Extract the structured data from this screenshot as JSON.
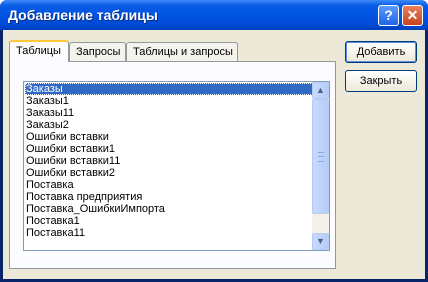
{
  "window": {
    "title": "Добавление таблицы",
    "help_glyph": "?",
    "close_glyph": "✕"
  },
  "tabs": [
    {
      "label": "Таблицы",
      "active": true
    },
    {
      "label": "Запросы",
      "active": false
    },
    {
      "label": "Таблицы и запросы",
      "active": false
    }
  ],
  "list": {
    "items": [
      "Заказы",
      "Заказы1",
      "Заказы11",
      "Заказы2",
      "Ошибки вставки",
      "Ошибки вставки1",
      "Ошибки вставки11",
      "Ошибки вставки2",
      "Поставка",
      "Поставка предприятия",
      "Поставка_ОшибкиИмпорта",
      "Поставка1",
      "Поставка11"
    ],
    "selected": "Заказы",
    "scroll_up_glyph": "▲",
    "scroll_down_glyph": "▼"
  },
  "buttons": {
    "add_label": "Добавить",
    "close_label": "Закрыть"
  },
  "colors": {
    "title_bar": "#0054e3",
    "selection": "#316ac5",
    "dialog_bg": "#ece9d8"
  }
}
